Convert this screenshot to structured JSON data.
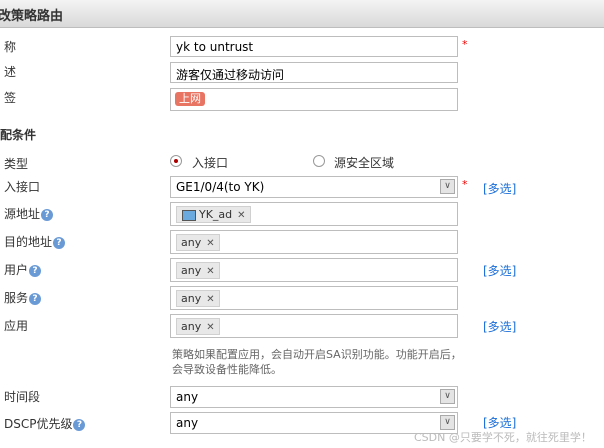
{
  "header": {
    "title": "改策略路由"
  },
  "fields": {
    "name": {
      "label": "称",
      "value": "yk to untrust",
      "required": "*"
    },
    "desc": {
      "label": "述",
      "value": "游客仅通过移动访问"
    },
    "tag": {
      "label": "签",
      "value": "上网"
    }
  },
  "match": {
    "section": "配条件",
    "type_label": "类型",
    "type_options": [
      "入接口",
      "源安全区域"
    ],
    "type_selected": "入接口",
    "ingress": {
      "label": "入接口",
      "value": "GE1/0/4(to YK)",
      "required": "*",
      "multi": "[多选]"
    },
    "src": {
      "label": "源地址",
      "tag": "YK_ad"
    },
    "dst": {
      "label": "目的地址",
      "tag": "any"
    },
    "user": {
      "label": "用户",
      "tag": "any",
      "multi": "[多选]"
    },
    "service": {
      "label": "服务",
      "tag": "any"
    },
    "app": {
      "label": "应用",
      "tag": "any",
      "multi": "[多选]"
    },
    "hint": "策略如果配置应用，会自动开启SA识别功能。功能开启后，会导致设备性能降低。",
    "time": {
      "label": "时间段",
      "value": "any"
    },
    "dscp": {
      "label": "DSCP优先级",
      "value": "any",
      "multi": "[多选]"
    }
  },
  "help_icon": "?",
  "remove_icon": "✕",
  "watermark": "CSDN @只要学不死，就往死里学！"
}
